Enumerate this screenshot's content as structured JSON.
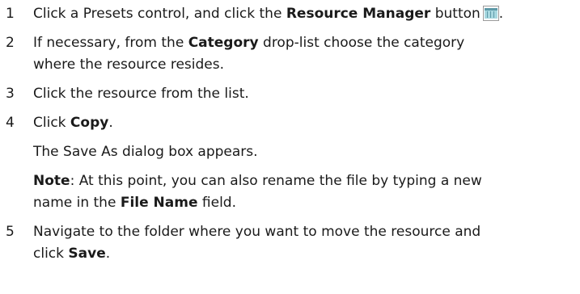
{
  "steps": [
    {
      "number": "1",
      "pre": "Click a Presets control, and click the ",
      "bold": "Resource Manager",
      "post": " button",
      "end": ".",
      "icon": "resource-manager-icon"
    },
    {
      "number": "2",
      "line1_pre": "If necessary, from the ",
      "line1_bold": "Category",
      "line1_post": " drop-list choose the category",
      "line2": "where the resource resides."
    },
    {
      "number": "3",
      "text": "Click the resource from the list."
    },
    {
      "number": "4",
      "pre": "Click ",
      "bold": "Copy",
      "post": ".",
      "result": "The Save As dialog box appears.",
      "note_label": "Note",
      "note_line1": ": At this point, you can also rename the file by typing a new",
      "note_line2_pre": "name in the ",
      "note_line2_bold": "File Name",
      "note_line2_post": " field."
    },
    {
      "number": "5",
      "line1": "Navigate to the folder where you want to move the resource and",
      "line2_pre": "click ",
      "line2_bold": "Save",
      "line2_post": "."
    }
  ],
  "colors": {
    "text": "#1a1a1a",
    "icon_frame": "#9a9a9a",
    "icon_fill": "#a8d8e0",
    "icon_header": "#5e9aa8"
  }
}
